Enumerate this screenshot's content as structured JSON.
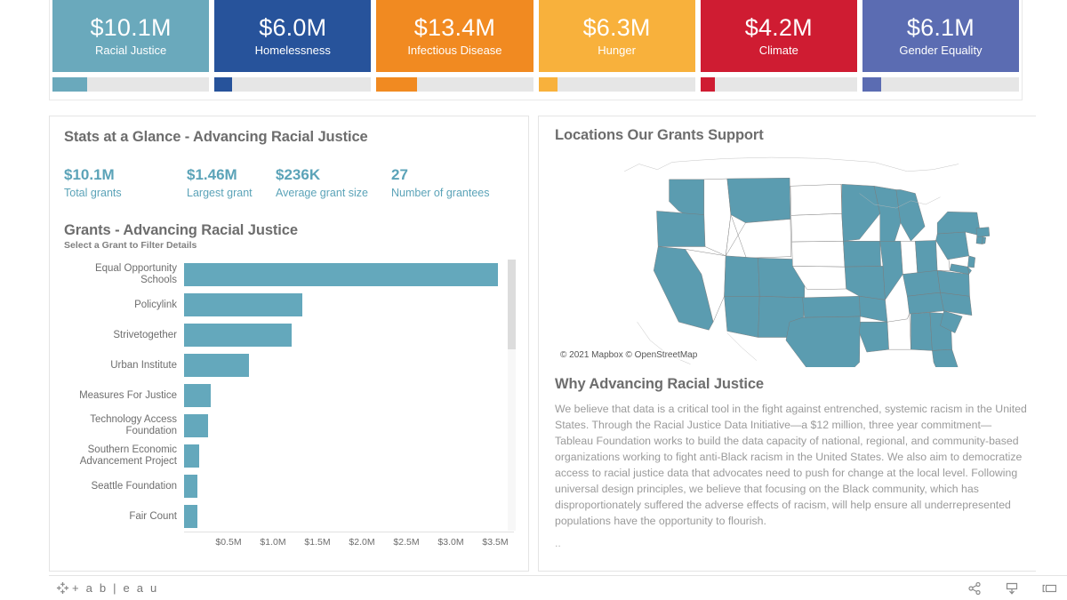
{
  "kpi": {
    "cards": [
      {
        "value": "$10.1M",
        "label": "Racial Justice",
        "color": "#6aa9bc",
        "fill_pct": 22
      },
      {
        "value": "$6.0M",
        "label": "Homelessness",
        "color": "#27539b",
        "fill_pct": 11
      },
      {
        "value": "$13.4M",
        "label": "Infectious Disease",
        "color": "#f18a21",
        "fill_pct": 26
      },
      {
        "value": "$6.3M",
        "label": "Hunger",
        "color": "#f8b13c",
        "fill_pct": 12
      },
      {
        "value": "$4.2M",
        "label": "Climate",
        "color": "#cf1c32",
        "fill_pct": 9
      },
      {
        "value": "$6.1M",
        "label": "Gender Equality",
        "color": "#5b6cb2",
        "fill_pct": 12
      }
    ]
  },
  "stats_panel": {
    "title": "Stats at a Glance - Advancing Racial Justice",
    "stats": [
      {
        "value": "$10.1M",
        "label": "Total grants"
      },
      {
        "value": "$1.46M",
        "label": "Largest grant"
      },
      {
        "value": "$236K",
        "label": "Average grant size"
      },
      {
        "value": "27",
        "label": "Number of grantees"
      }
    ],
    "grants_title": "Grants - Advancing Racial Justice",
    "grants_subtitle": "Select a Grant to Filter Details"
  },
  "chart_data": {
    "type": "bar",
    "title": "Grants - Advancing Racial Justice",
    "subtitle": "Select a Grant to Filter Details",
    "orientation": "horizontal",
    "xlabel": "",
    "ylabel": "",
    "xlim": [
      0,
      3.7
    ],
    "grid": false,
    "legend": "none",
    "bar_color": "#64a8bc",
    "tick_labels": [
      "$0.5M",
      "$1.0M",
      "$1.5M",
      "$2.0M",
      "$2.5M",
      "$3.0M",
      "$3.5M"
    ],
    "tick_values": [
      0.5,
      1.0,
      1.5,
      2.0,
      2.5,
      3.0,
      3.5
    ],
    "categories": [
      "Equal Opportunity Schools",
      "Policylink",
      "Strivetogether",
      "Urban Institute",
      "Measures For Justice",
      "Technology Access Foundation",
      "Southern Economic Advancement Project",
      "Seattle Foundation",
      "Fair Count"
    ],
    "values": [
      3.53,
      1.33,
      1.21,
      0.73,
      0.3,
      0.27,
      0.17,
      0.15,
      0.15
    ],
    "scroll_thumb_pct": 33
  },
  "map_panel": {
    "title": "Locations Our Grants Support",
    "attribution": "© 2021 Mapbox  © OpenStreetMap",
    "fill_color": "#5b9cb0",
    "highlighted_states": [
      "WA",
      "OR",
      "CA",
      "MT",
      "UT",
      "AZ",
      "CO",
      "NM",
      "TX",
      "OK",
      "MN",
      "IA",
      "MO",
      "AR",
      "LA",
      "WI",
      "IL",
      "MI",
      "OH",
      "KY",
      "TN",
      "AL",
      "GA",
      "FL",
      "SC",
      "NC",
      "VA",
      "MD",
      "DE",
      "NJ",
      "PA",
      "NY",
      "CT",
      "RI",
      "MA"
    ],
    "unhighlighted_states": [
      "ID",
      "WY",
      "NV",
      "ND",
      "SD",
      "NE",
      "KS",
      "IN",
      "WV",
      "MS"
    ]
  },
  "why_panel": {
    "title": "Why Advancing Racial Justice",
    "body": "We believe that data is a critical tool in the fight against entrenched, systemic racism in the United States. Through the Racial Justice Data Initiative—a $12 million, three year commitment—Tableau Foundation works to build the data capacity of national, regional, and community-based organizations working to fight anti-Black racism in the United States. We also aim to democratize access to racial justice data that advocates need to push for change at the local level. Following universal design principles, we believe that focusing on the Black community, which has disproportionately suffered the adverse effects of racism, will help ensure all underrepresented populations have the opportunity to flourish.",
    "ellipsis": ".."
  },
  "footer": {
    "brand": "+ a b | e a u",
    "icons": [
      "share-icon",
      "download-icon",
      "fullscreen-icon"
    ]
  }
}
